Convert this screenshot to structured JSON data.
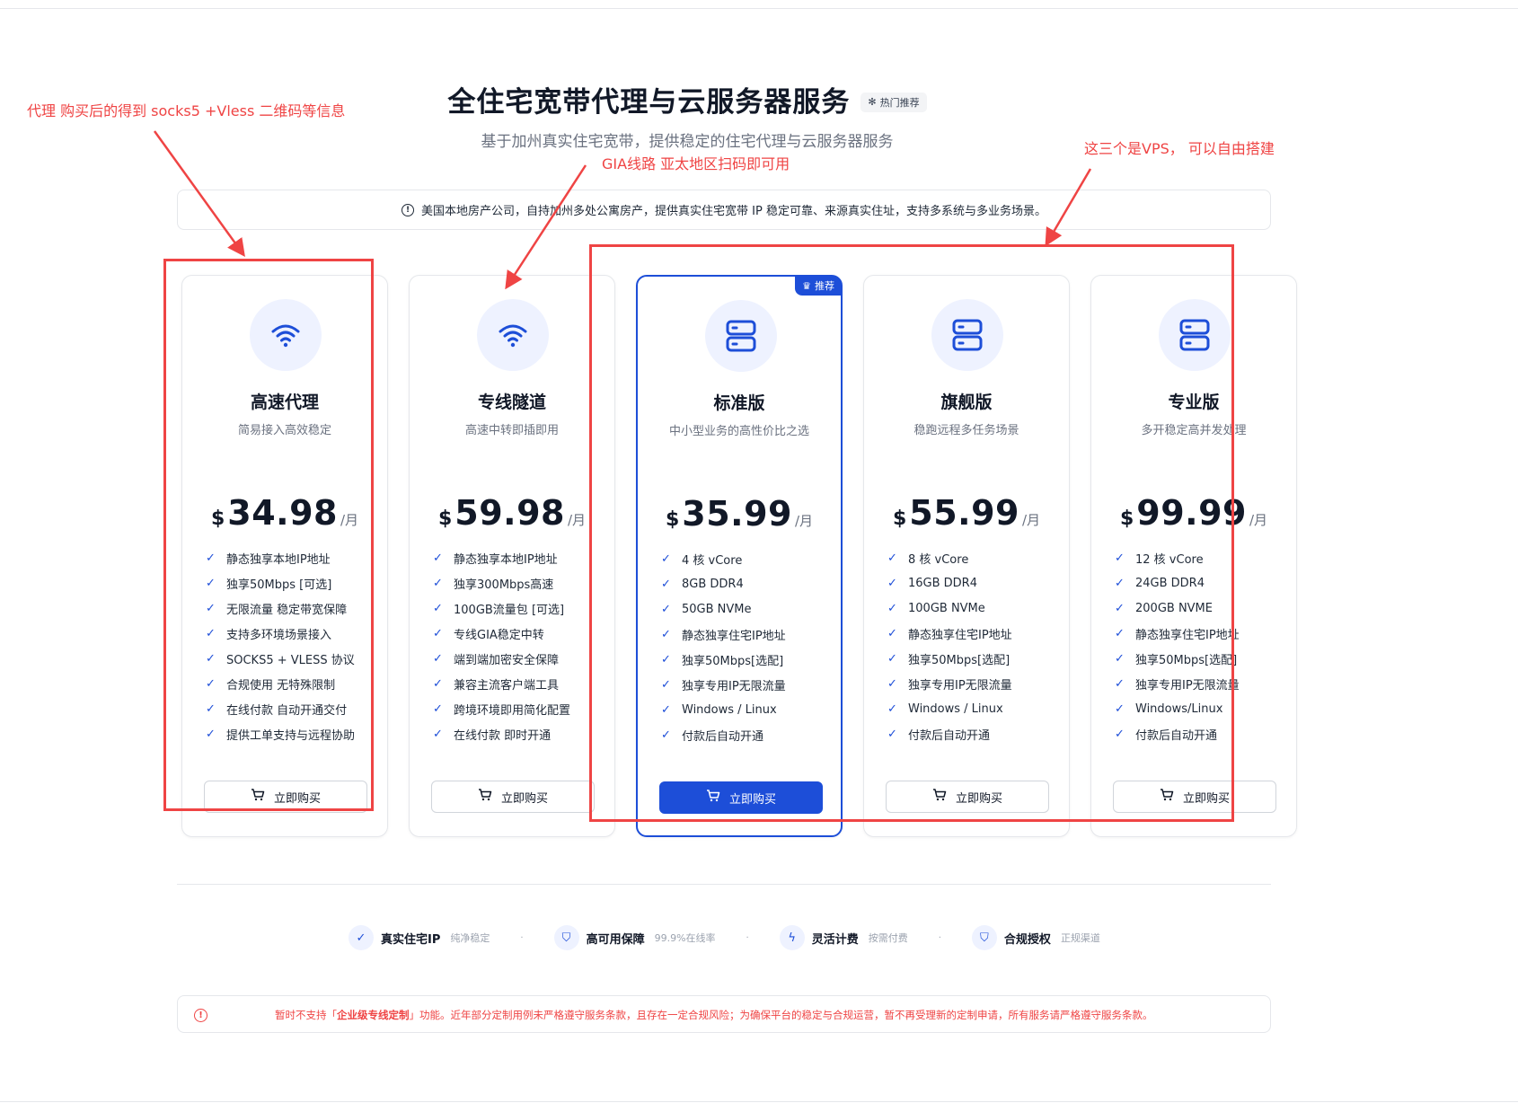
{
  "header": {
    "title": "全住宅宽带代理与云服务器服务",
    "hot_badge": "热门推荐",
    "subtitle": "基于加州真实住宅宽带，提供稳定的住宅代理与云服务器服务"
  },
  "notice": "美国本地房产公司，自持加州多处公寓房产，提供真实住宅宽带 IP 稳定可靠、来源真实住址，支持多系统与多业务场景。",
  "currency": "$",
  "buy_label": "立即购买",
  "recommend_badge": "推荐",
  "plans": [
    {
      "icon": "wifi-icon",
      "name": "高速代理",
      "desc": "简易接入高效稳定",
      "price": "34.98",
      "unit": "/月",
      "features": [
        "静态独享本地IP地址",
        "独享50Mbps [可选]",
        "无限流量 稳定带宽保障",
        "支持多环境场景接入",
        "SOCKS5 + VLESS 协议",
        "合规使用 无特殊限制",
        "在线付款 自动开通交付",
        "提供工单支持与远程协助"
      ]
    },
    {
      "icon": "wifi-icon",
      "name": "专线隧道",
      "desc": "高速中转即插即用",
      "price": "59.98",
      "unit": "/月",
      "features": [
        "静态独享本地IP地址",
        "独享300Mbps高速",
        "100GB流量包 [可选]",
        "专线GIA稳定中转",
        "端到端加密安全保障",
        "兼容主流客户端工具",
        "跨境环境即用简化配置",
        "在线付款 即时开通"
      ]
    },
    {
      "icon": "server-icon",
      "name": "标准版",
      "desc": "中小型业务的高性价比之选",
      "price": "35.99",
      "unit": "/月",
      "features": [
        "4 核 vCore",
        "8GB DDR4",
        "50GB NVMe",
        "静态独享住宅IP地址",
        "独享50Mbps[选配]",
        "独享专用IP无限流量",
        "Windows / Linux",
        "付款后自动开通"
      ]
    },
    {
      "icon": "server-icon",
      "name": "旗舰版",
      "desc": "稳跑远程多任务场景",
      "price": "55.99",
      "unit": "/月",
      "features": [
        "8 核 vCore",
        "16GB DDR4",
        "100GB NVMe",
        "静态独享住宅IP地址",
        "独享50Mbps[选配]",
        "独享专用IP无限流量",
        "Windows / Linux",
        "付款后自动开通"
      ]
    },
    {
      "icon": "server-icon",
      "name": "专业版",
      "desc": "多开稳定高并发处理",
      "price": "99.99",
      "unit": "/月",
      "features": [
        "12 核 vCore",
        "24GB DDR4",
        "200GB NVME",
        "静态独享住宅IP地址",
        "独享50Mbps[选配]",
        "独享专用IP无限流量",
        "Windows/Linux",
        "付款后自动开通"
      ]
    }
  ],
  "strip": [
    {
      "icon": "check-icon",
      "title": "真实住宅IP",
      "sub": "纯净稳定"
    },
    {
      "icon": "shield-icon",
      "title": "高可用保障",
      "sub": "99.9%在线率"
    },
    {
      "icon": "bolt-icon",
      "title": "灵活计费",
      "sub": "按需付费"
    },
    {
      "icon": "shield-icon",
      "title": "合规授权",
      "sub": "正规渠道"
    }
  ],
  "warning": {
    "before": "暂时不支持「",
    "highlight": "企业级专线定制",
    "after": "」功能。近年部分定制用例未严格遵守服务条款，且存在一定合规风险；为确保平台的稳定与合规运营，暂不再受理新的定制申请，所有服务请严格遵守服务条款。"
  },
  "annotations": {
    "left": "代理 购买后的得到 socks5 +Vless  二维码等信息",
    "middle": "GIA线路 亚太地区扫码即可用",
    "right": "这三个是VPS， 可以自由搭建"
  },
  "colors": {
    "accent": "#1d4ed8",
    "annotation": "#ef4444"
  }
}
